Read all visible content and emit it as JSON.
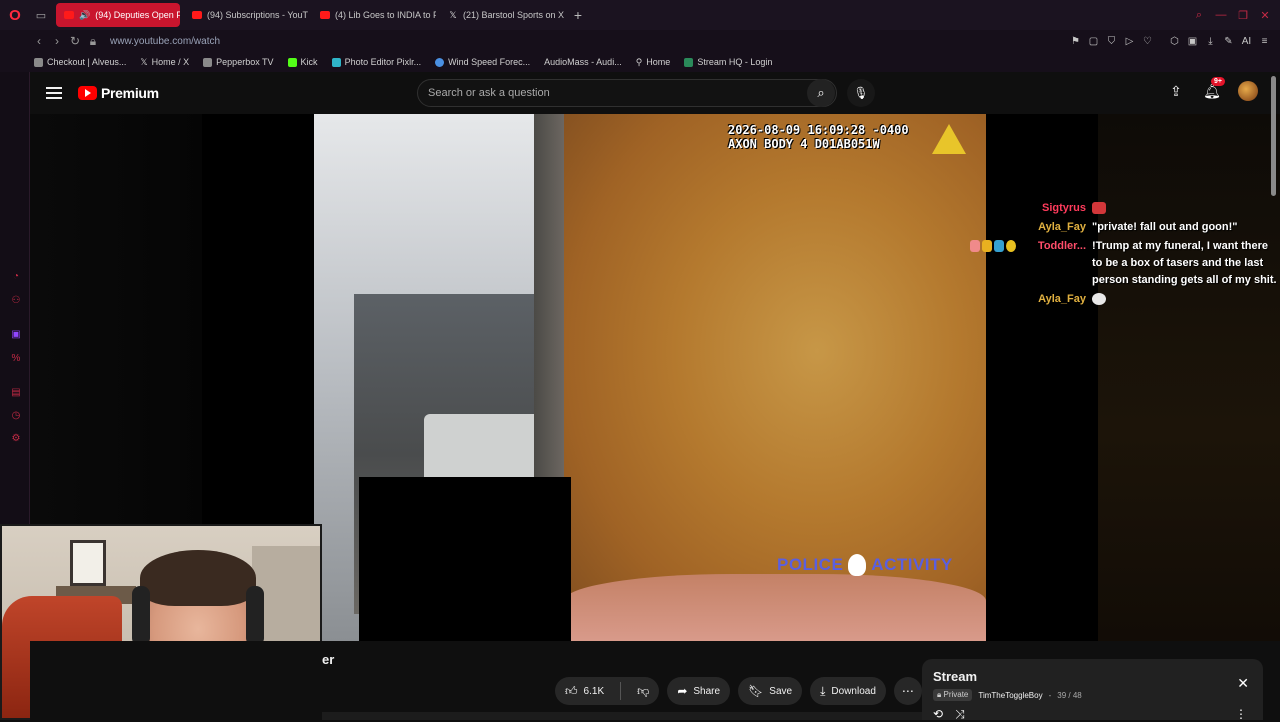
{
  "browser": {
    "tabs": [
      {
        "label": "(94) Deputies Open Fir",
        "active": true,
        "type": "yt"
      },
      {
        "label": "(94) Subscriptions - YouTu",
        "active": false,
        "type": "yt"
      },
      {
        "label": "(4) Lib Goes to INDIA to Pr",
        "active": false,
        "type": "yt"
      },
      {
        "label": "(21) Barstool Sports on X: ",
        "active": false,
        "type": "x"
      }
    ],
    "url": "www.youtube.com/watch",
    "bookmarks": [
      "Checkout | Alveus...",
      "Home / X",
      "Pepperbox TV",
      "Kick",
      "Photo Editor Pixlr...",
      "Wind Speed Forec...",
      "AudioMass - Audi...",
      "Home",
      "Stream HQ - Login"
    ],
    "accent": "#c9152e"
  },
  "youtube": {
    "brand": "Premium",
    "search_placeholder": "Search or ask a question",
    "notif_count": "9+"
  },
  "video": {
    "timestamp": "2026-08-09 16:09:28 -0400",
    "device": "AXON BODY 4 D01AB051W",
    "logo_left": "POLICE",
    "logo_right": "ACTIVITY"
  },
  "chat": [
    {
      "name": "Sigtyrus",
      "color": "#ff3b5c",
      "message": ""
    },
    {
      "name": "Ayla_Fay",
      "color": "#e0b040",
      "message": "\"private! fall out and goon!\""
    },
    {
      "name": "Toddler...",
      "color": "#ff4d6a",
      "message": "!Trump at my funeral, I want there to be a box of tasers and the last person standing gets all of my shit."
    },
    {
      "name": "Ayla_Fay",
      "color": "#e0b040",
      "message": ""
    }
  ],
  "below": {
    "title_fragment": "er",
    "like_count": "6.1K",
    "share_label": "Share",
    "save_label": "Save",
    "download_label": "Download"
  },
  "playlist": {
    "title": "Stream",
    "privacy": "Private",
    "owner": "TimTheToggleBoy",
    "position": "39 / 48"
  }
}
